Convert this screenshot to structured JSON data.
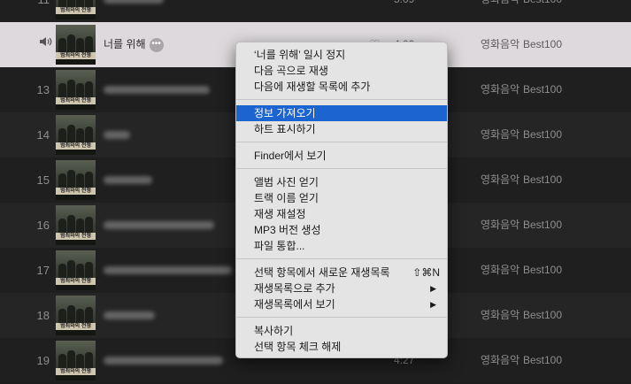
{
  "tracks": [
    {
      "num": "11",
      "title": "",
      "time": "5:09",
      "genre": "영화음악",
      "playlist": "Best100"
    },
    {
      "num": "",
      "title": "너를 위해",
      "time": "4:00",
      "genre": "영화음악",
      "playlist": "Best100"
    },
    {
      "num": "13",
      "title": "",
      "time": "",
      "genre": "영화음악",
      "playlist": "Best100"
    },
    {
      "num": "14",
      "title": "",
      "time": "",
      "genre": "영화음악",
      "playlist": "Best100"
    },
    {
      "num": "15",
      "title": "",
      "time": "",
      "genre": "영화음악",
      "playlist": "Best100"
    },
    {
      "num": "16",
      "title": "",
      "time": "",
      "genre": "영화음악",
      "playlist": "Best100"
    },
    {
      "num": "17",
      "title": "",
      "time": "",
      "genre": "영화음악",
      "playlist": "Best100"
    },
    {
      "num": "18",
      "title": "",
      "time": "",
      "genre": "영화음악",
      "playlist": "Best100"
    },
    {
      "num": "19",
      "title": "",
      "time": "4:27",
      "genre": "영화음악",
      "playlist": "Best100"
    }
  ],
  "album_art_text": "범죄와의 전쟁",
  "more_label": "•••",
  "context_menu": {
    "items": [
      "‘너를 위해’ 일시 정지",
      "다음 곡으로 재생",
      "다음에 재생할 목록에 추가",
      "정보 가져오기",
      "하트 표시하기",
      "Finder에서 보기",
      "앨범 사진 얻기",
      "트랙 이름 얻기",
      "재생 재설정",
      "MP3 버전 생성",
      "파일 통합...",
      "선택 항목에서 새로운 재생목록",
      "재생목록으로 추가",
      "재생목록에서 보기",
      "복사하기",
      "선택 항목 체크 해제"
    ],
    "new_playlist_shortcut": "⇧⌘N",
    "highlight_color": "#1c64cf"
  },
  "icons": {
    "speaker": "speaker-icon",
    "heart": "heart-icon",
    "submenu": "submenu-arrow-icon"
  }
}
